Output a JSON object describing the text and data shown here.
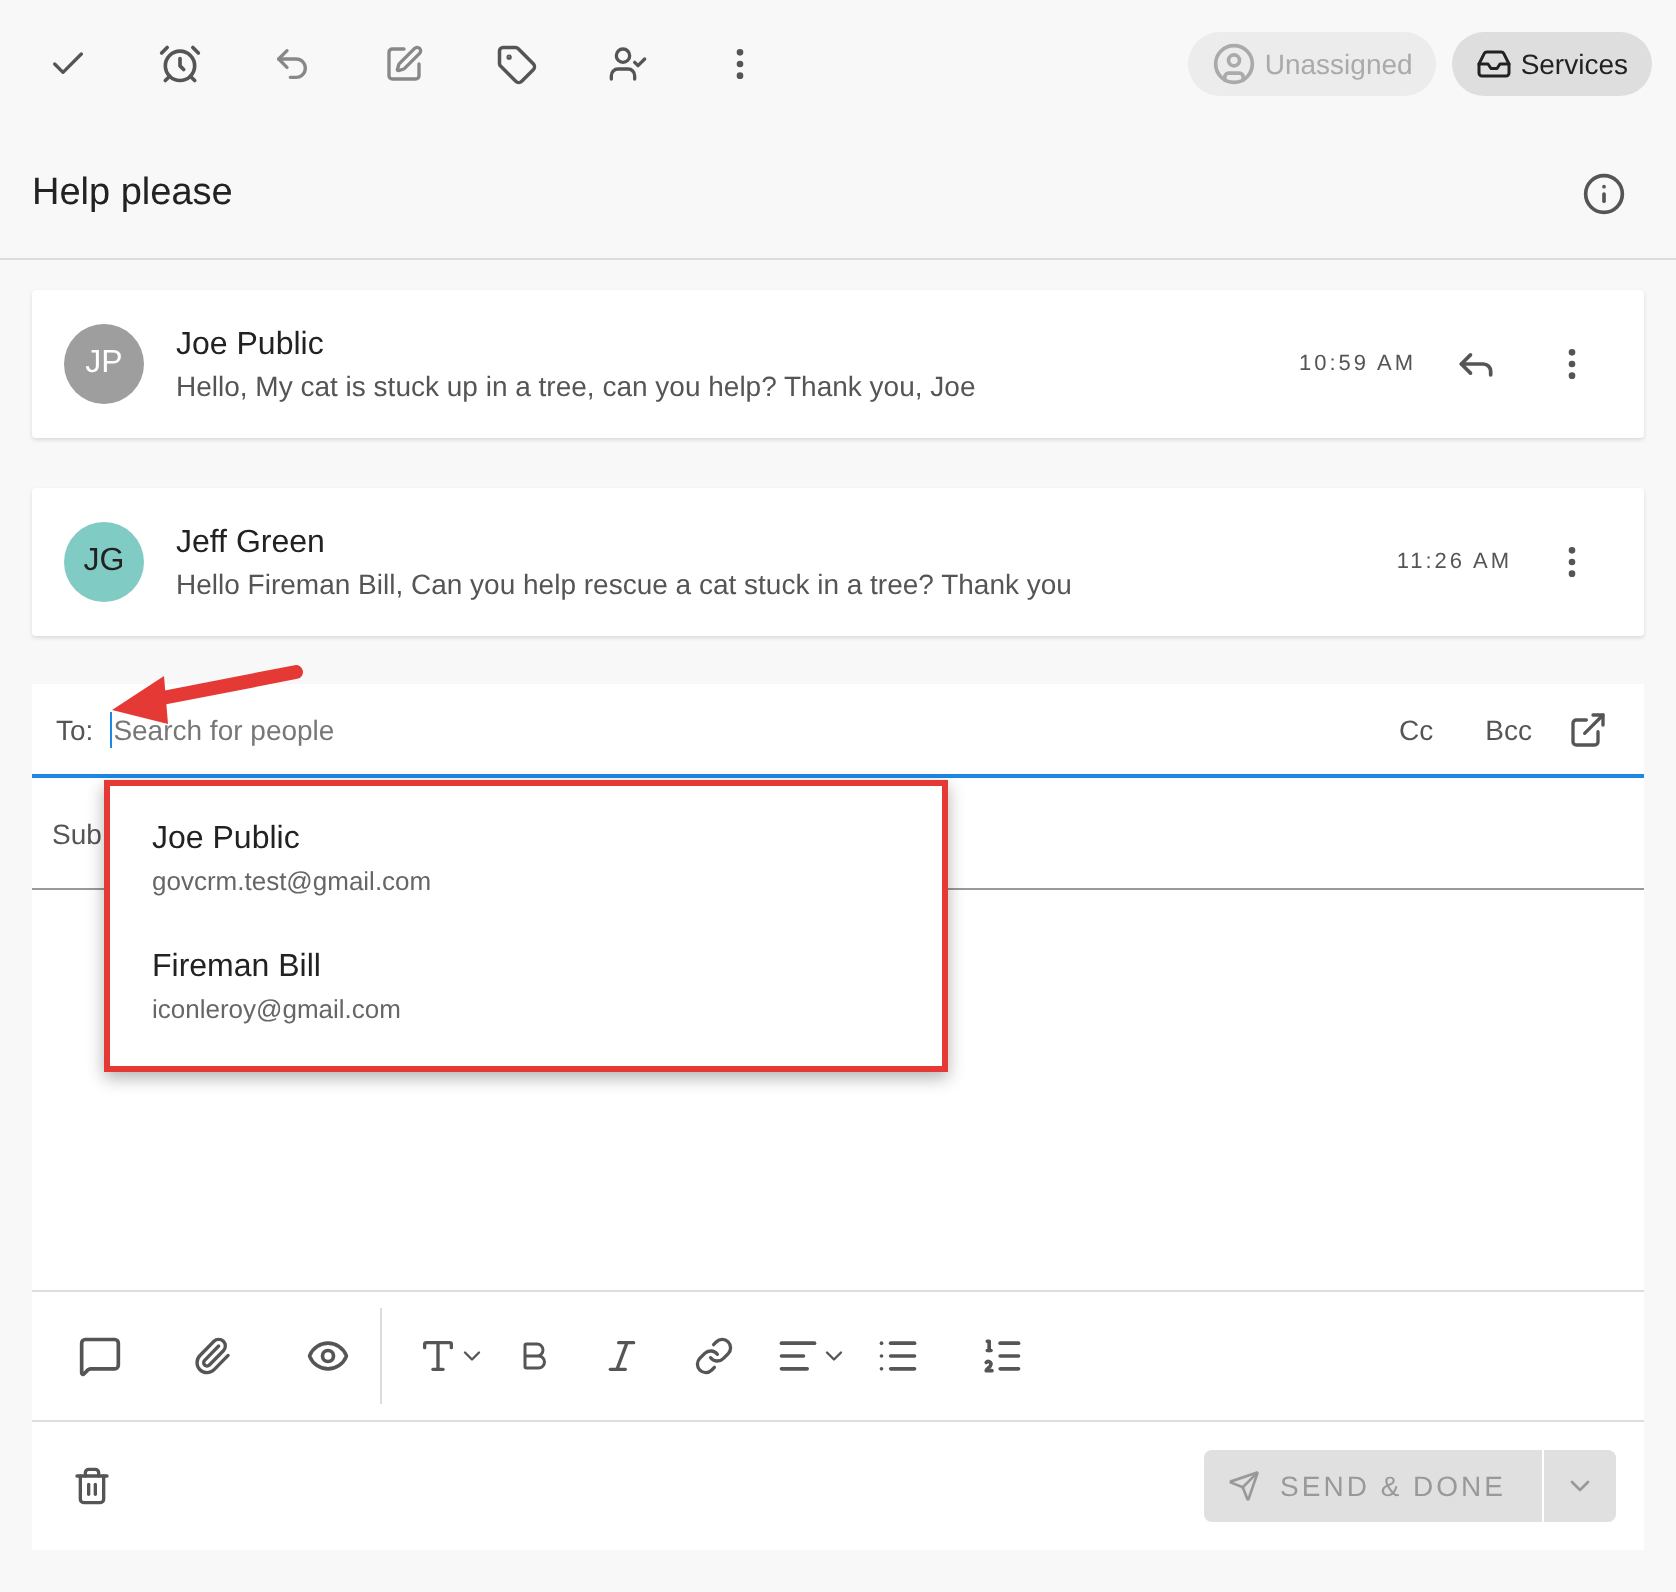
{
  "toolbar": {
    "assignee": {
      "label": "Unassigned",
      "disabled": true
    },
    "inbox": {
      "label": "Services"
    }
  },
  "title": "Help please",
  "messages": [
    {
      "initials": "JP",
      "color": "#9e9e9e",
      "name": "Joe Public",
      "preview": "Hello, My cat is stuck up in a tree, can you help? Thank you, Joe",
      "time": "10:59 AM",
      "reply_button": true
    },
    {
      "initials": "JG",
      "color": "#80cbc4",
      "name": "Jeff Green",
      "preview": "Hello Fireman Bill, Can you help rescue a cat stuck in a tree? Thank you",
      "time": "11:26 AM",
      "reply_button": false
    }
  ],
  "composer": {
    "to_label": "To:",
    "to_placeholder": "Search for people",
    "cc": "Cc",
    "bcc": "Bcc",
    "subject_label": "Sub",
    "suggestions": [
      {
        "name": "Joe Public",
        "email": "govcrm.test@gmail.com"
      },
      {
        "name": "Fireman Bill",
        "email": "iconleroy@gmail.com"
      }
    ],
    "send": {
      "label": "SEND & DONE",
      "disabled": true
    }
  }
}
